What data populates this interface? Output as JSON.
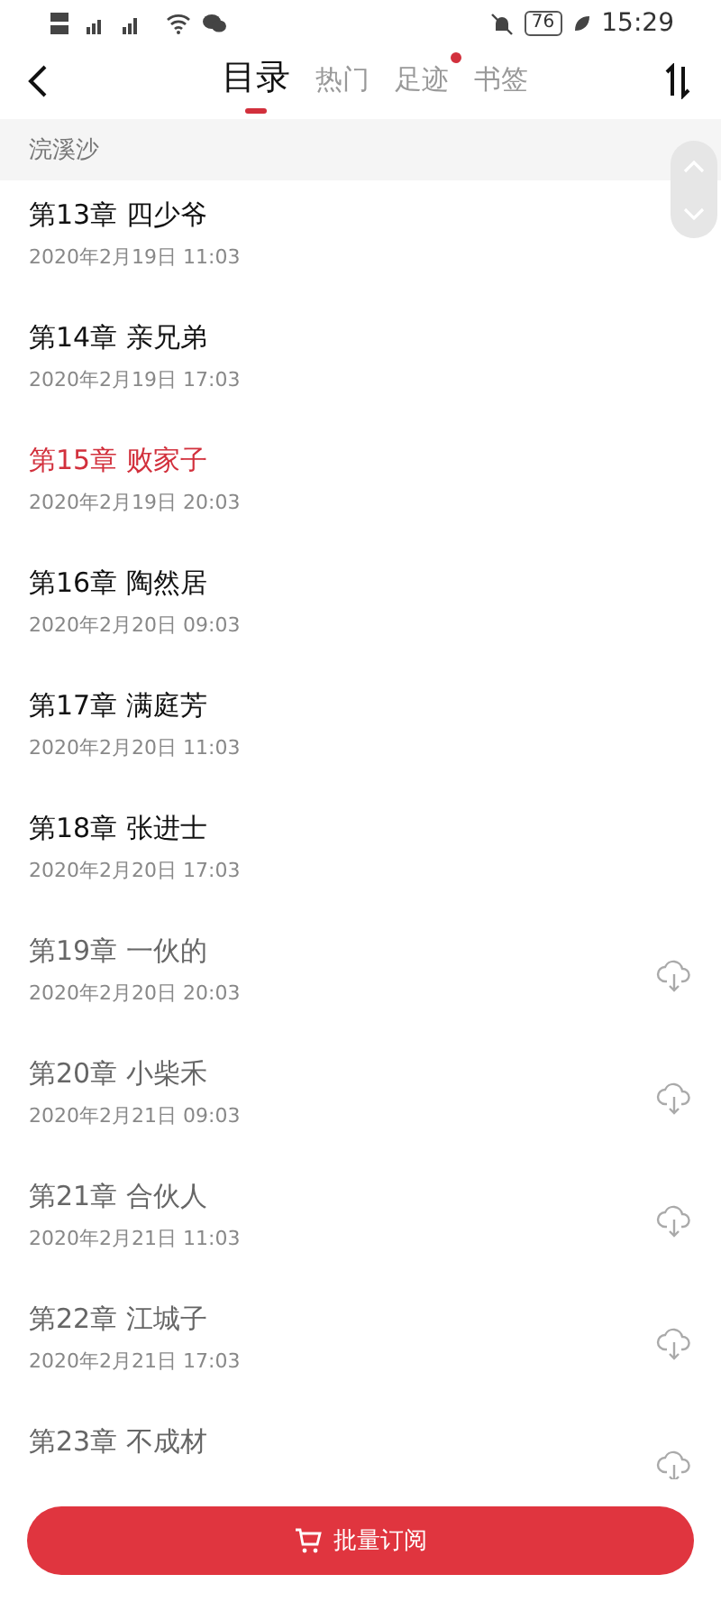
{
  "status_bar": {
    "battery": "76",
    "time": "15:29"
  },
  "tabs": [
    {
      "label": "目录",
      "selected": true,
      "dot": false
    },
    {
      "label": "热门",
      "selected": false,
      "dot": false
    },
    {
      "label": "足迹",
      "selected": false,
      "dot": true
    },
    {
      "label": "书签",
      "selected": false,
      "dot": false
    }
  ],
  "section": "浣溪沙",
  "chapters": [
    {
      "title": "第13章 四少爷",
      "date": "2020年2月19日 11:03",
      "selected": false,
      "locked": false
    },
    {
      "title": "第14章 亲兄弟",
      "date": "2020年2月19日 17:03",
      "selected": false,
      "locked": false
    },
    {
      "title": "第15章 败家子",
      "date": "2020年2月19日 20:03",
      "selected": true,
      "locked": false
    },
    {
      "title": "第16章 陶然居",
      "date": "2020年2月20日 09:03",
      "selected": false,
      "locked": false
    },
    {
      "title": "第17章 满庭芳",
      "date": "2020年2月20日 11:03",
      "selected": false,
      "locked": false
    },
    {
      "title": "第18章 张进士",
      "date": "2020年2月20日 17:03",
      "selected": false,
      "locked": false
    },
    {
      "title": "第19章 一伙的",
      "date": "2020年2月20日 20:03",
      "selected": false,
      "locked": true
    },
    {
      "title": "第20章 小柴禾",
      "date": "2020年2月21日 09:03",
      "selected": false,
      "locked": true
    },
    {
      "title": "第21章 合伙人",
      "date": "2020年2月21日 11:03",
      "selected": false,
      "locked": true
    },
    {
      "title": "第22章 江城子",
      "date": "2020年2月21日 17:03",
      "selected": false,
      "locked": true
    },
    {
      "title": "第23章 不成材",
      "selected": false,
      "locked": true
    }
  ],
  "subscribe_button": "批量订阅"
}
